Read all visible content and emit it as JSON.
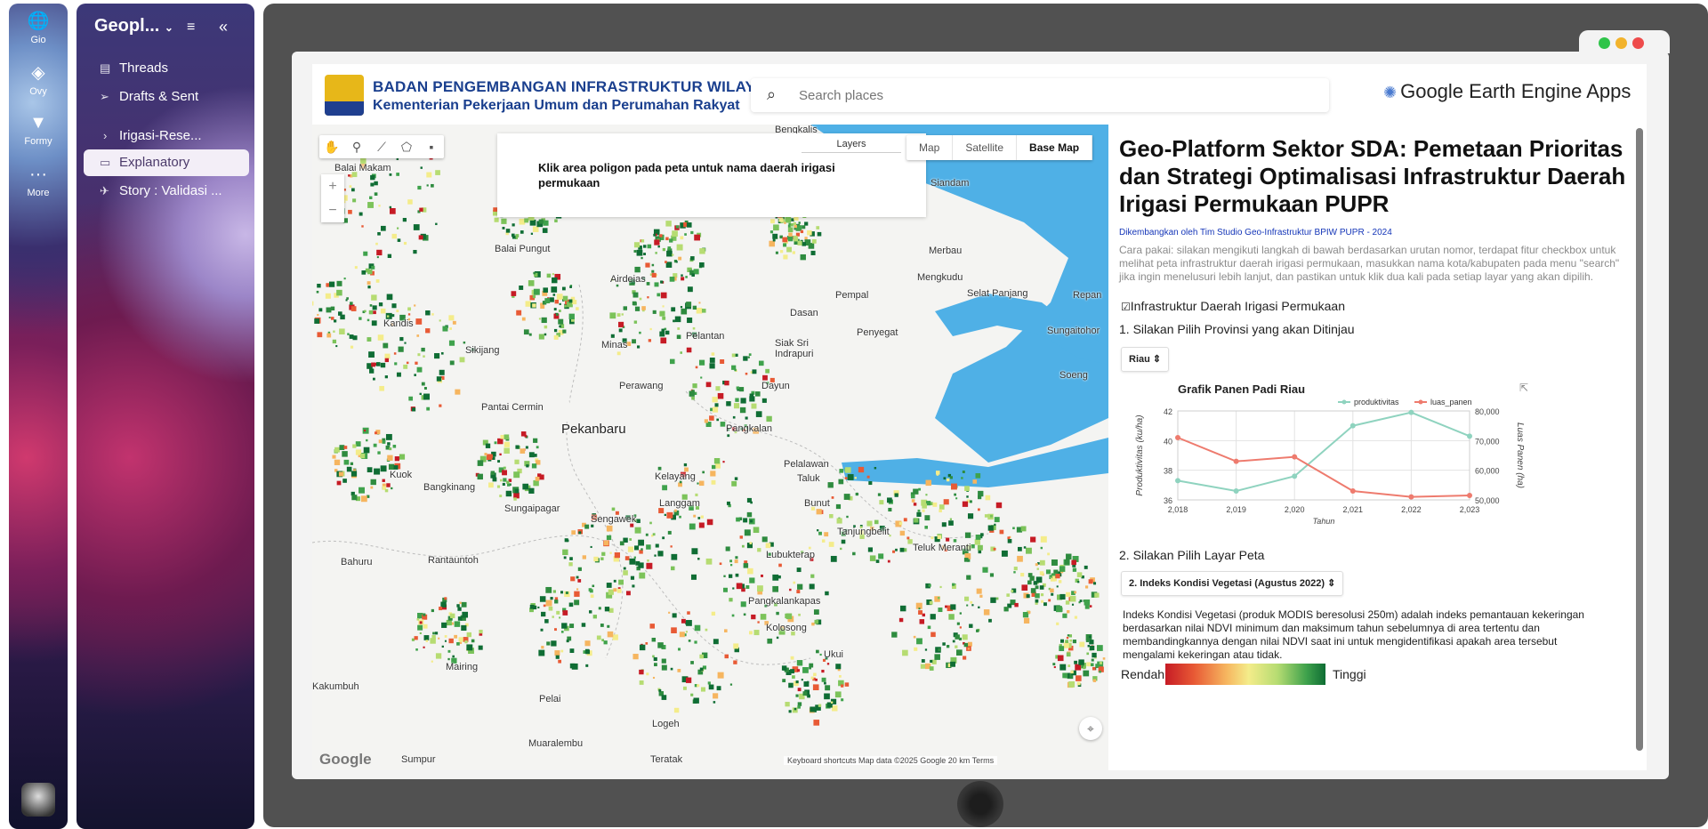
{
  "rail": {
    "items": [
      {
        "label": "Gio",
        "icon": "globe-icon"
      },
      {
        "label": "Ovy",
        "icon": "layers-icon"
      },
      {
        "label": "Formy",
        "icon": "form-icon"
      },
      {
        "label": "More",
        "icon": "more-icon"
      }
    ]
  },
  "sidebar": {
    "title": "Geopl...",
    "items": [
      {
        "label": "Threads",
        "icon": "threads-icon"
      },
      {
        "label": "Drafts & Sent",
        "icon": "send-icon"
      },
      {
        "label": "Irigasi-Rese...",
        "icon": "chevron-right-icon"
      },
      {
        "label": "Explanatory",
        "icon": "document-icon",
        "active": true
      },
      {
        "label": "Story : Validasi ...",
        "icon": "rocket-icon"
      }
    ]
  },
  "header": {
    "org_line1": "BADAN PENGEMBANGAN INFRASTRUKTUR WILAYAH",
    "org_line2": "Kementerian Pekerjaan Umum dan Perumahan Rakyat",
    "search_placeholder": "Search places",
    "brand": "Google Earth Engine Apps"
  },
  "map": {
    "info": "Klik area poligon pada peta untuk nama daerah irigasi permukaan",
    "layers_label": "Layers",
    "map_types": [
      "Map",
      "Satellite",
      "Base Map"
    ],
    "selected_map_type": "Base Map",
    "zoom": [
      "+",
      "−"
    ],
    "google": "Google",
    "attribution": "Keyboard shortcuts    Map data ©2025 Google    20 km    Terms",
    "places": [
      "Bengkalis",
      "Balai Makam",
      "Siandam",
      "Balai Pungut",
      "Merbau",
      "Mengkudu",
      "Selat Panjang",
      "Repan",
      "Airdeias",
      "Pempal",
      "Dasan",
      "Penyegat",
      "Sungaitohor",
      "Minas",
      "Pelantan",
      "Indrapuri",
      "Siak Sri",
      "Kandis",
      "Sikijang",
      "Perawang",
      "Dayun",
      "Soeng",
      "Pantai Cermin",
      "Pekanbaru",
      "Pangkalan",
      "Kuok",
      "Bangkinang",
      "Pelalawan",
      "Kelayang",
      "Taluk",
      "Langgam",
      "Bunut",
      "Sungaipagar",
      "Sengawek",
      "Tanjungbelit",
      "Teluk Meranti",
      "Bahuru",
      "Lubukterap",
      "Rantauntoh",
      "Pangkalankapas",
      "Kolosong",
      "Ukui",
      "Mairing",
      "Pelai",
      "Logeh",
      "Muaralembu",
      "Sumpur",
      "Teratak",
      "Kakumbuh"
    ]
  },
  "panel": {
    "title": "Geo-Platform Sektor SDA: Pemetaan Prioritas dan Strategi Optimalisasi Infrastruktur Daerah Irigasi Permukaan PUPR",
    "credit": "Dikembangkan oleh Tim Studio Geo-Infrastruktur BPIW PUPR - 2024",
    "usage": "Cara pakai: silakan mengikuti langkah di bawah berdasarkan urutan nomor, terdapat fitur checkbox untuk melihat peta infrastruktur daerah irigasi permukaan, masukkan nama kota/kabupaten pada menu \"search\" jika ingin menelusuri lebih lanjut, dan pastikan untuk klik dua kali pada setiap layar yang akan dipilih.",
    "checkbox_label": "Infrastruktur Daerah Irigasi Permukaan",
    "step1": "1. Silakan Pilih Provinsi yang akan Ditinjau",
    "province": "Riau",
    "step2": "2. Silakan Pilih Layar Peta",
    "layer": "2. Indeks Kondisi Vegetasi (Agustus 2022)",
    "description": "Indeks Kondisi Vegetasi (produk MODIS beresolusi 250m) adalah indeks pemantauan kekeringan berdasarkan nilai NDVI minimum dan maksimum tahun sebelumnya di area tertentu dan membandingkannya dengan nilai NDVI saat ini untuk mengidentifikasi apakah area tersebut mengalami kekeringan atau tidak.",
    "legend_low": "Rendah",
    "legend_high": "Tinggi"
  },
  "chart_data": {
    "type": "line",
    "title": "Grafik Panen Padi Riau",
    "xlabel": "Tahun",
    "x": [
      2018,
      2019,
      2020,
      2021,
      2022,
      2023
    ],
    "x_tick_labels": [
      "2,018",
      "2,019",
      "2,020",
      "2,021",
      "2,022",
      "2,023"
    ],
    "series": [
      {
        "name": "produktivitas",
        "axis": "left",
        "color": "#8fd3bf",
        "values": [
          37.3,
          36.6,
          37.6,
          41.0,
          41.9,
          40.3
        ]
      },
      {
        "name": "luas_panen",
        "axis": "right",
        "color": "#ee7b6e",
        "values": [
          71000,
          63000,
          64500,
          53000,
          51000,
          51500
        ]
      }
    ],
    "y_left": {
      "label": "Produktivitas (ku/ha)",
      "min": 36,
      "max": 42,
      "ticks": [
        36,
        38,
        40,
        42
      ]
    },
    "y_right": {
      "label": "Luas Panen (ha)",
      "min": 50000,
      "max": 80000,
      "ticks": [
        "50,000",
        "60,000",
        "70,000",
        "80,000"
      ]
    },
    "legend_position": "top-right",
    "grid": true
  }
}
